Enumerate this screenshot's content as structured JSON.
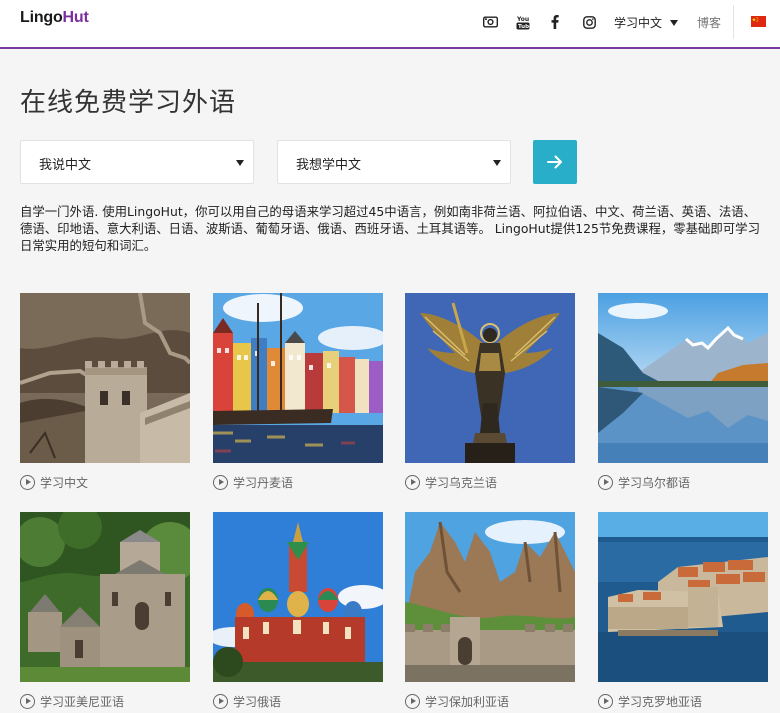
{
  "header": {
    "logo_part1": "Lingo",
    "logo_part2": "Hut",
    "icons": [
      "camera-icon",
      "youtube-icon",
      "facebook-icon",
      "instagram-icon",
      "china-flag-icon"
    ],
    "language_menu_label": "学习中文",
    "blog_label": "博客",
    "accent_color": "#7b3aa3"
  },
  "main": {
    "headline": "在线免费学习外语",
    "speak_select": "我说中文",
    "learn_select": "我想学中文",
    "go_button_icon": "arrow-right-icon",
    "go_button_color": "#29aec9",
    "intro": "自学一门外语. 使用LingoHut，你可以用自己的母语来学习超过45中语言，例如南非荷兰语、阿拉伯语、中文、荷兰语、英语、法语、德语、印地语、意大利语、日语、波斯语、葡萄牙语、俄语、西班牙语、土耳其语等。 LingoHut提供125节免费课程，零基础即可学习日常实用的短句和词汇。"
  },
  "courses": [
    {
      "label": "学习中文",
      "image": "great-wall"
    },
    {
      "label": "学习丹麦语",
      "image": "nyhavn-harbor"
    },
    {
      "label": "学习乌克兰语",
      "image": "archangel-statue"
    },
    {
      "label": "学习乌尔都语",
      "image": "mountain-lake"
    },
    {
      "label": "学习亚美尼亚语",
      "image": "armenian-monastery"
    },
    {
      "label": "学习俄语",
      "image": "st-basils-cathedral"
    },
    {
      "label": "学习保加利亚语",
      "image": "belogradchik-fortress"
    },
    {
      "label": "学习克罗地亚语",
      "image": "dubrovnik"
    }
  ]
}
